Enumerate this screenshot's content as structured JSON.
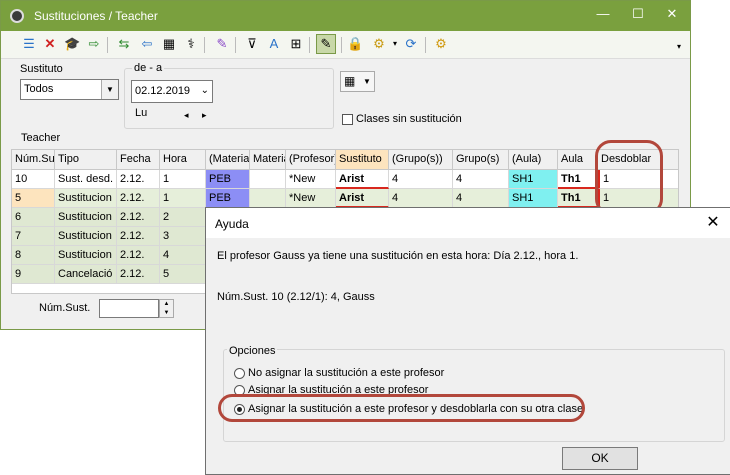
{
  "window": {
    "title": "Sustituciones / Teacher"
  },
  "toolbar": {
    "icons": [
      "list-icon",
      "delete-icon",
      "graduation-cap-icon",
      "export-icon",
      "substitute-icon",
      "import-icon",
      "calculator-icon",
      "stethoscope-icon",
      "magic-wand-icon",
      "filter-icon",
      "sort-icon",
      "grid-icon",
      "edit-icon",
      "lock-icon",
      "settings-dropdown-icon",
      "help-icon",
      "gear-icon"
    ]
  },
  "filters": {
    "substitute_label": "Sustituto",
    "substitute_value": "Todos",
    "range_label": "de - a",
    "date_value": "02.12.2019",
    "weekday": "Lu",
    "nav_prev": "◂",
    "nav_next": "▸",
    "checkbox_label": "Clases sin sustitución",
    "section_label": "Teacher"
  },
  "grid": {
    "columns": [
      "Núm.Su",
      "Tipo",
      "Fecha",
      "Hora",
      "(Materia)",
      "Materia",
      "(Profesor)",
      "Sustituto",
      "(Grupo(s))",
      "Grupo(s)",
      "(Aula)",
      "Aula",
      "Desdoblar"
    ],
    "rows": [
      [
        "10",
        "Sust. desd.",
        "2.12.",
        "1",
        "PEB",
        "",
        "*New",
        "Arist",
        "4",
        "4",
        "SH1",
        "Th1",
        "1"
      ],
      [
        "5",
        "Sustitucion",
        "2.12.",
        "1",
        "PEB",
        "",
        "*New",
        "Arist",
        "4",
        "4",
        "SH1",
        "Th1",
        "1"
      ],
      [
        "6",
        "Sustitucion",
        "2.12.",
        "2",
        "",
        "",
        "",
        "",
        "",
        "",
        "",
        "",
        ""
      ],
      [
        "7",
        "Sustitucion",
        "2.12.",
        "3",
        "",
        "",
        "",
        "",
        "",
        "",
        "",
        "",
        ""
      ],
      [
        "8",
        "Sustitucion",
        "2.12.",
        "4",
        "",
        "",
        "",
        "",
        "",
        "",
        "",
        "",
        ""
      ],
      [
        "9",
        "Cancelació",
        "2.12.",
        "5",
        "",
        "",
        "",
        "",
        "",
        "",
        "",
        "",
        ""
      ]
    ]
  },
  "footer": {
    "num_sust_label": "Núm.Sust."
  },
  "dialog": {
    "title": "Ayuda",
    "close": "✕",
    "message": "El profesor Gauss ya tiene una sustitución en esta hora: Día 2.12., hora 1.",
    "detail": "Núm.Sust. 10 (2.12/1): 4, Gauss",
    "options_label": "Opciones",
    "options": [
      "No asignar la sustitución a este profesor",
      "Asignar la sustitución a este profesor",
      "Asignar la sustitución a este profesor y desdoblarla con su otra clase"
    ],
    "selected_option": 3,
    "ok_label": "OK"
  },
  "colors": {
    "titlebar": "#7aa03e",
    "highlight": "#b2473b",
    "subject_cell": "#8c8ef5",
    "room_cell": "#7ff0f0"
  }
}
